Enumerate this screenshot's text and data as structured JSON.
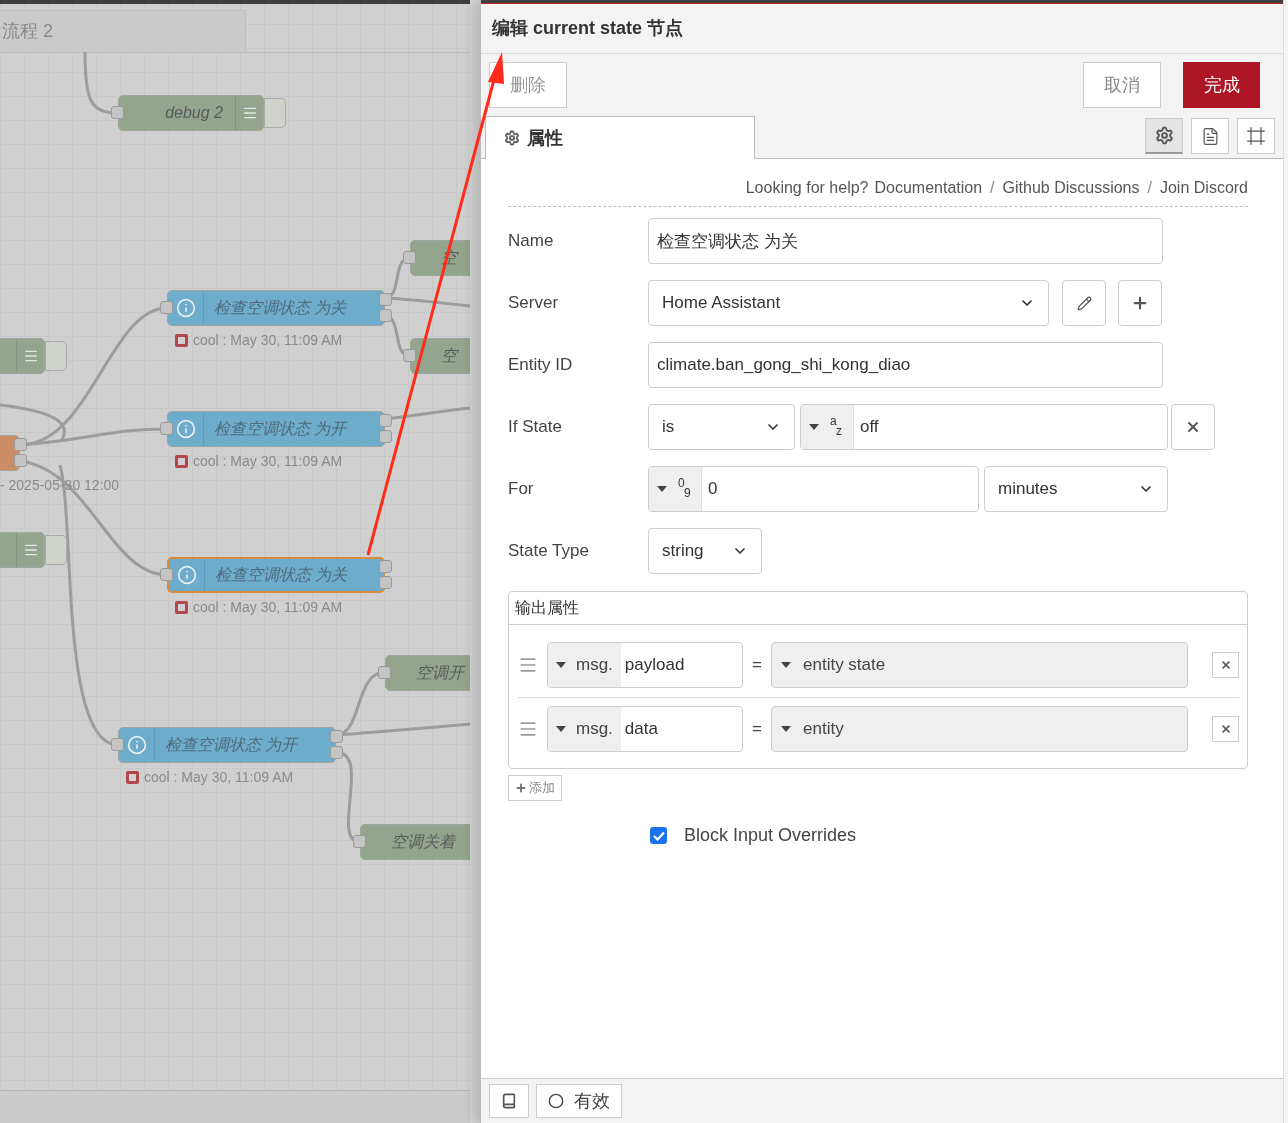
{
  "canvas": {
    "flow_tab": "流程 2",
    "nodes": [
      {
        "kind": "debug",
        "label": "debug 2",
        "selected": false
      },
      {
        "kind": "change",
        "label": "空",
        "selected": false
      },
      {
        "kind": "state",
        "label": "检查空调状态 为关",
        "selected": false,
        "status": "cool : May 30, 11:09 AM"
      },
      {
        "kind": "change",
        "label": "空",
        "selected": false
      },
      {
        "kind": "debug",
        "selected": false
      },
      {
        "kind": "state",
        "label": "检查空调状态 为开",
        "selected": false,
        "status": "cool : May 30, 11:09 AM"
      },
      {
        "kind": "inject",
        "selected": false,
        "status": "- 2025-05-30 12:00"
      },
      {
        "kind": "debug",
        "selected": false
      },
      {
        "kind": "state",
        "label": "检查空调状态 为关",
        "selected": true,
        "status": "cool : May 30, 11:09 AM"
      },
      {
        "kind": "change",
        "label": "空调开",
        "selected": false
      },
      {
        "kind": "state",
        "label": "检查空调状态 为开",
        "selected": false,
        "status": "cool : May 30, 11:09 AM"
      },
      {
        "kind": "change",
        "label": "空调关着",
        "selected": false
      }
    ]
  },
  "editor": {
    "title": "编辑 current state 节点",
    "delete_button": "删除",
    "cancel_button": "取消",
    "done_button": "完成",
    "tabs": [
      {
        "label": "属性",
        "selected": true
      }
    ],
    "icon_tabs": [
      {
        "kind": "settings",
        "selected": true
      },
      {
        "kind": "description",
        "selected": false
      },
      {
        "kind": "appearance",
        "selected": false
      }
    ],
    "help": {
      "prompt": "Looking for help?",
      "links": [
        "Documentation",
        "Github Discussions",
        "Join Discord"
      ],
      "separator": "/"
    },
    "name": {
      "label": "Name",
      "value": "检查空调状态 为关"
    },
    "server": {
      "label": "Server",
      "value": "Home Assistant"
    },
    "entity_id": {
      "label": "Entity ID",
      "value": "climate.ban_gong_shi_kong_diao"
    },
    "if_state": {
      "label": "If State",
      "operator": "is",
      "type_marks": [
        "a",
        "z"
      ],
      "value": "off"
    },
    "for": {
      "label": "For",
      "type_marks": [
        "0",
        "9"
      ],
      "value": "0",
      "unit": "minutes"
    },
    "state_type": {
      "label": "State Type",
      "value": "string"
    },
    "output_properties": {
      "title": "输出属性",
      "rows": [
        {
          "prefix": "msg.",
          "property": "payload",
          "operator": "=",
          "value": "entity state"
        },
        {
          "prefix": "msg.",
          "property": "data",
          "operator": "=",
          "value": "entity"
        }
      ],
      "add_button": "添加"
    },
    "block_input_overrides": {
      "label": "Block Input Overrides",
      "checked": true
    },
    "footer": {
      "enabled_label": "有效"
    }
  }
}
